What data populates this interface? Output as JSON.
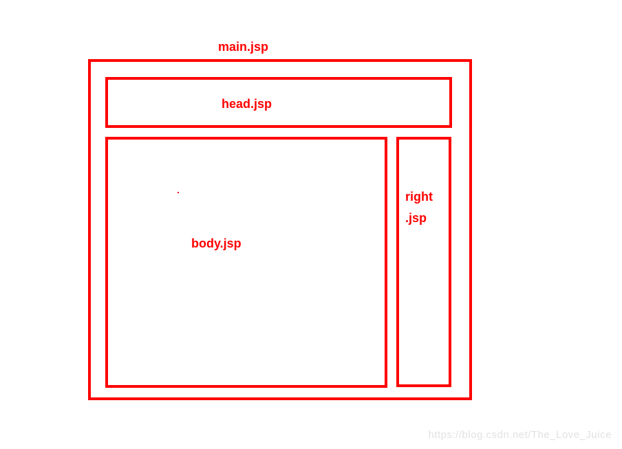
{
  "labels": {
    "main": "main.jsp",
    "head": "head.jsp",
    "body": "body.jsp",
    "right": "right",
    "right_ext": ".jsp"
  },
  "watermark": "https://blog.csdn.net/The_Love_Juice"
}
